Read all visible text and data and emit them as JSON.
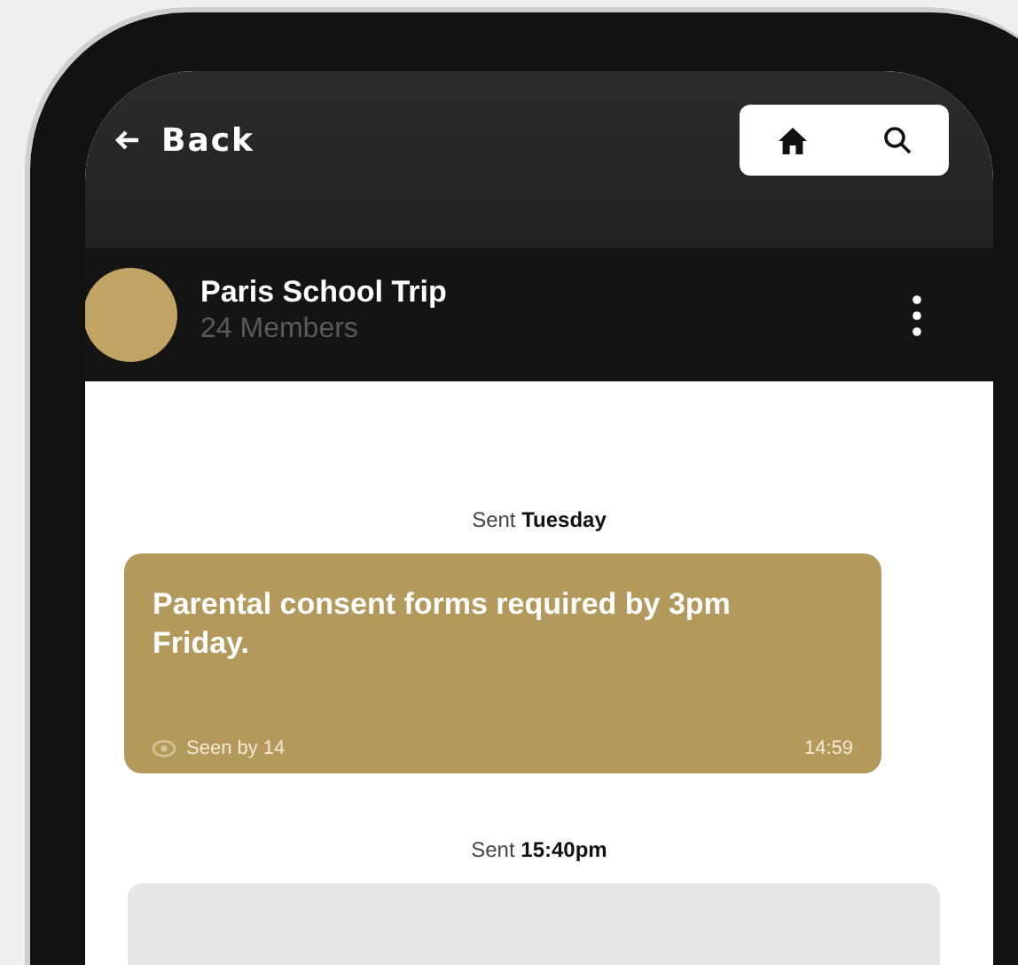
{
  "nav": {
    "back_label": "Back"
  },
  "group": {
    "name": "Paris School Trip",
    "members": "24 Members"
  },
  "messages": [
    {
      "kind": "text",
      "sent_label": "Sent **Tuesday**",
      "text": "Parental consent forms required by 3pm Friday.",
      "seen": "Seen by 14",
      "time": "14:59"
    },
    {
      "kind": "blank",
      "sent_label": "Sent **15:40pm**"
    }
  ]
}
